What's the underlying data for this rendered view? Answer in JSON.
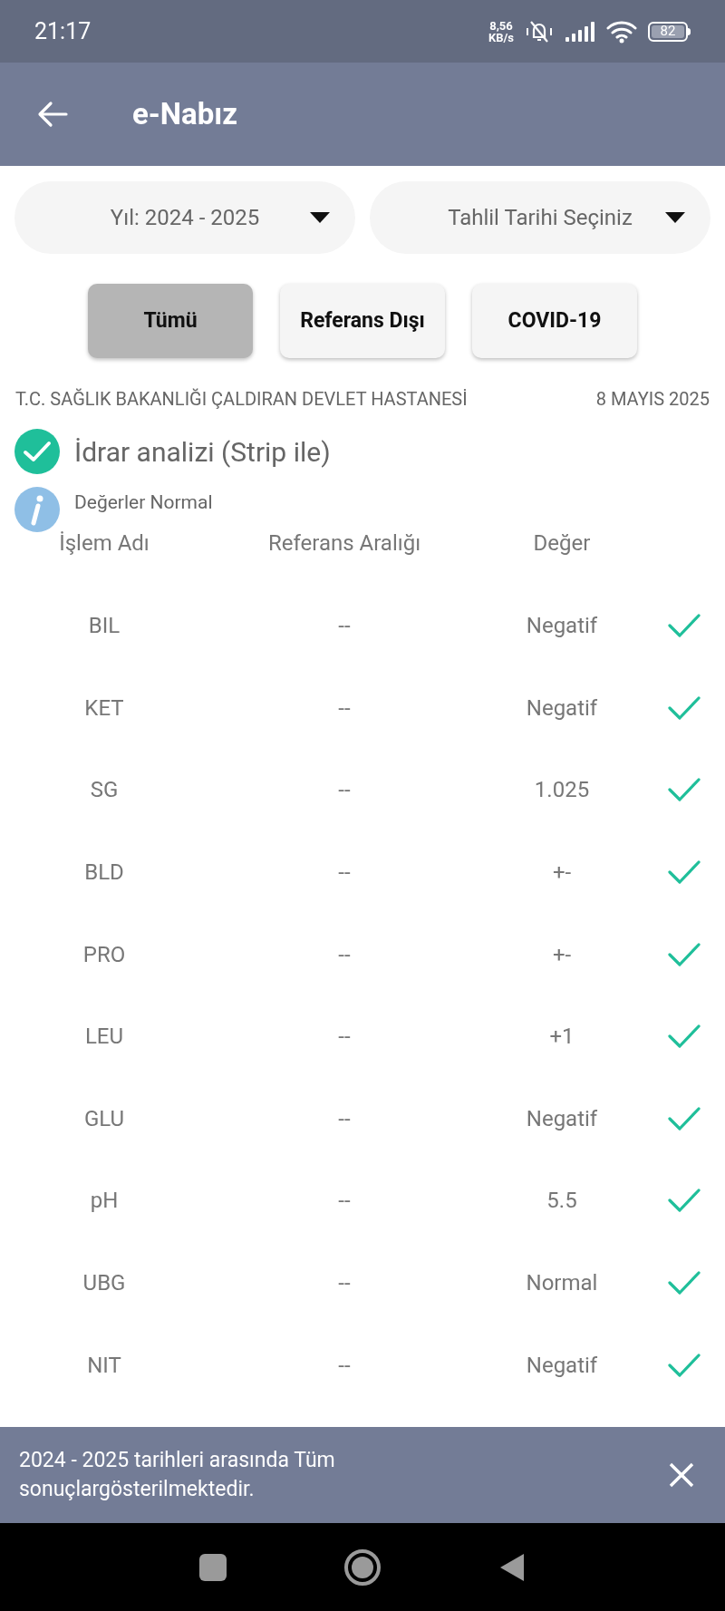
{
  "status_bar": {
    "time": "21:17",
    "net_speed_value": "8,56",
    "net_speed_unit": "KB/s",
    "battery": "82"
  },
  "app_bar": {
    "title": "e-Nabız"
  },
  "dropdowns": [
    {
      "label": "Yıl: 2024 - 2025"
    },
    {
      "label": "Tahlil Tarihi Seçiniz"
    }
  ],
  "filters": [
    {
      "label": "Tümü",
      "selected": true
    },
    {
      "label": "Referans Dışı",
      "selected": false
    },
    {
      "label": "COVID-19",
      "selected": false
    }
  ],
  "result": {
    "hospital": "T.C. SAĞLIK BAKANLIĞI ÇALDIRAN DEVLET HASTANESİ",
    "date": "8 MAYIS 2025",
    "test_name": "İdrar analizi (Strip ile)",
    "normal": true,
    "info": "Değerler Normal",
    "columns": [
      "İşlem Adı",
      "Referans Aralığı",
      "Değer"
    ],
    "rows": [
      {
        "name": "BIL",
        "range": "--",
        "value": "Negatif",
        "ok": true
      },
      {
        "name": "KET",
        "range": "--",
        "value": "Negatif",
        "ok": true
      },
      {
        "name": "SG",
        "range": "--",
        "value": "1.025",
        "ok": true
      },
      {
        "name": "BLD",
        "range": "--",
        "value": "+-",
        "ok": true
      },
      {
        "name": "PRO",
        "range": "--",
        "value": "+-",
        "ok": true
      },
      {
        "name": "LEU",
        "range": "--",
        "value": "+1",
        "ok": true
      },
      {
        "name": "GLU",
        "range": "--",
        "value": "Negatif",
        "ok": true
      },
      {
        "name": "pH",
        "range": "--",
        "value": "5.5",
        "ok": true
      },
      {
        "name": "UBG",
        "range": "--",
        "value": "Normal",
        "ok": true
      },
      {
        "name": "NIT",
        "range": "--",
        "value": "Negatif",
        "ok": true
      }
    ]
  },
  "snackbar": {
    "message": "2024 - 2025 tarihleri arasında Tüm sonuçlargösterilmektedir."
  }
}
